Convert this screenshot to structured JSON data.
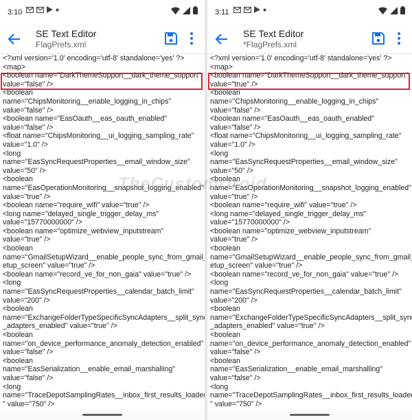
{
  "watermark": "TheCustomDroid",
  "colors": {
    "accent_blue": "#1a73e8",
    "highlight_red": "#d8262d"
  },
  "screens": [
    {
      "status": {
        "time": "3:10",
        "icons": [
          "gmail-icon",
          "gmail-icon",
          "play-icon",
          "dot-icon",
          "wifi-icon",
          "signal-icon",
          "battery-icon"
        ]
      },
      "app": {
        "title": "SE Text Editor",
        "subtitle": "FlagPrefs.xml"
      },
      "lines": [
        "<?xml version='1.0' encoding='utf-8' standalone='yes' ?>",
        "<map>",
        "    <boolean name=\"DarkThemeSupport__dark_theme_support\"",
        "value=\"false\" />",
        "    <boolean",
        "name=\"ChipsMonitoring__enable_logging_in_chips\"",
        "value=\"false\" />",
        "    <boolean name=\"EasOauth__eas_oauth_enabled\"",
        "value=\"false\" />",
        "    <float name=\"ChipsMonitoring__ui_logging_sampling_rate\"",
        "value=\"1.0\" />",
        "    <long",
        "name=\"EasSyncRequestProperties__email_window_size\"",
        "value=\"50\" />",
        "    <boolean",
        "name=\"EasOperationMonitoring__snapshot_logging_enabled\"",
        "value=\"true\" />",
        "    <boolean name=\"require_wifi\" value=\"true\" />",
        "    <long name=\"delayed_single_trigger_delay_ms\"",
        "value=\"15770000000\" />",
        "    <boolean name=\"optimize_webview_inputstream\"",
        "value=\"true\" />",
        "    <boolean",
        "name=\"GmailSetupWizard__enable_people_sync_from_gmail_s",
        "etup_screen\" value=\"true\" />",
        "    <boolean name=\"record_ve_for_non_gaia\" value=\"true\" />",
        "    <long",
        "name=\"EasSyncRequestProperties__calendar_batch_limit\"",
        "value=\"200\" />",
        "    <boolean",
        "name=\"ExchangeFolderTypeSpecificSyncAdapters__split_sync",
        "_adapters_enabled\" value=\"true\" />",
        "    <boolean",
        "name=\"on_device_performance_anomaly_detection_enabled\"",
        "value=\"false\" />",
        "    <boolean",
        "name=\"EasSerialization__enable_email_marshalling\"",
        "value=\"false\" />",
        "    <long",
        "name=\"TraceDepotSamplingRates__inbox_first_results_loaded",
        "\" value=\"750\" />"
      ]
    },
    {
      "status": {
        "time": "3:11",
        "icons": [
          "gmail-icon",
          "gmail-icon",
          "play-icon",
          "dot-icon",
          "wifi-icon",
          "signal-icon",
          "battery-icon"
        ]
      },
      "app": {
        "title": "SE Text Editor",
        "subtitle": "*FlagPrefs.xml"
      },
      "lines": [
        "<?xml version='1.0' encoding='utf-8' standalone='yes' ?>",
        "<map>",
        "    <boolean name=\"DarkThemeSupport__dark_theme_support\"",
        "value=\"true\" />",
        "    <boolean",
        "name=\"ChipsMonitoring__enable_logging_in_chips\"",
        "value=\"false\" />",
        "    <boolean name=\"EasOauth__eas_oauth_enabled\"",
        "value=\"false\" />",
        "    <float name=\"ChipsMonitoring__ui_logging_sampling_rate\"",
        "value=\"1.0\" />",
        "    <long",
        "name=\"EasSyncRequestProperties__email_window_size\"",
        "value=\"50\" />",
        "    <boolean",
        "name=\"EasOperationMonitoring__snapshot_logging_enabled\"",
        "value=\"true\" />",
        "    <boolean name=\"require_wifi\" value=\"true\" />",
        "    <long name=\"delayed_single_trigger_delay_ms\"",
        "value=\"15770000000\" />",
        "    <boolean name=\"optimize_webview_inputstream\"",
        "value=\"true\" />",
        "    <boolean",
        "name=\"GmailSetupWizard__enable_people_sync_from_gmail_s",
        "etup_screen\" value=\"true\" />",
        "    <boolean name=\"record_ve_for_non_gaia\" value=\"true\" />",
        "    <long",
        "name=\"EasSyncRequestProperties__calendar_batch_limit\"",
        "value=\"200\" />",
        "    <boolean",
        "name=\"ExchangeFolderTypeSpecificSyncAdapters__split_sync",
        "_adapters_enabled\" value=\"true\" />",
        "    <boolean",
        "name=\"on_device_performance_anomaly_detection_enabled\"",
        "value=\"false\" />",
        "    <boolean",
        "name=\"EasSerialization__enable_email_marshalling\"",
        "value=\"false\" />",
        "    <long",
        "name=\"TraceDepotSamplingRates__inbox_first_results_loaded",
        "\" value=\"750\" />"
      ]
    }
  ]
}
